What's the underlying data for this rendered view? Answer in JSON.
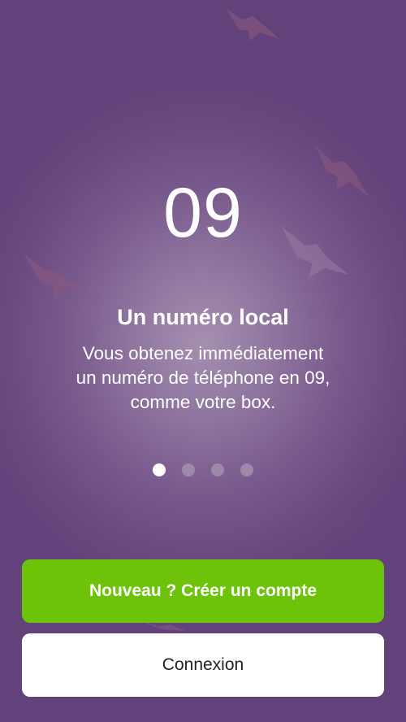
{
  "slide": {
    "big_number": "09",
    "title": "Un numéro local",
    "description": "Vous obtenez immédiatement\nun numéro de téléphone en 09,\ncomme votre box."
  },
  "pager": {
    "total": 4,
    "active_index": 0
  },
  "actions": {
    "create_account_label": "Nouveau ? Créer un compte",
    "login_label": "Connexion"
  },
  "colors": {
    "background": "#6a4a80",
    "primary_button": "#6cc30a",
    "secondary_button": "#ffffff"
  },
  "decorations": [
    "bird-icon",
    "bird-icon",
    "bird-icon",
    "bird-icon",
    "bird-icon"
  ]
}
